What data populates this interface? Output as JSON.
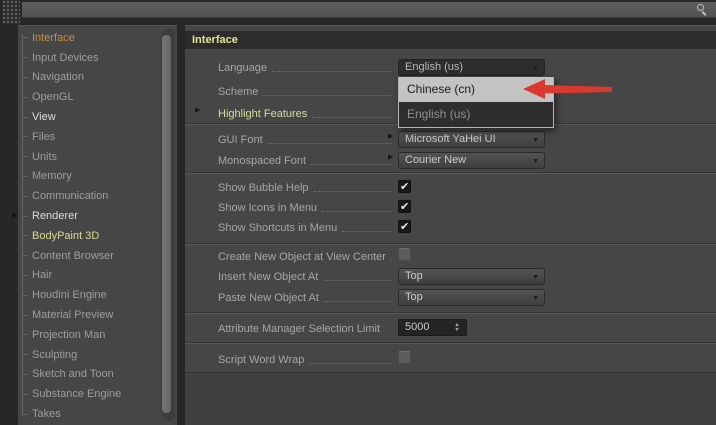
{
  "topbar": {
    "search_icon": "magnifier"
  },
  "icons": {
    "check": "✔",
    "dropdown_arrow": "▼",
    "expand_arrow": "▶",
    "spinner_up": "▲",
    "spinner_down": "▼"
  },
  "sidebar": {
    "items": [
      {
        "label": "Interface",
        "style": "sel"
      },
      {
        "label": "Input Devices"
      },
      {
        "label": "Navigation"
      },
      {
        "label": "OpenGL"
      },
      {
        "label": "View",
        "style": "active"
      },
      {
        "label": "Files"
      },
      {
        "label": "Units"
      },
      {
        "label": "Memory"
      },
      {
        "label": "Communication"
      },
      {
        "label": "Renderer",
        "style": "active",
        "expandable": true
      },
      {
        "label": "BodyPaint 3D",
        "style": "hl"
      },
      {
        "label": "Content Browser"
      },
      {
        "label": "Hair"
      },
      {
        "label": "Houdini Engine"
      },
      {
        "label": "Material Preview"
      },
      {
        "label": "Projection Man"
      },
      {
        "label": "Sculpting"
      },
      {
        "label": "Sketch and Toon"
      },
      {
        "label": "Substance Engine"
      },
      {
        "label": "Takes"
      }
    ]
  },
  "main": {
    "header": "Interface",
    "rows": {
      "language": {
        "label": "Language",
        "value": "English (us)"
      },
      "scheme": {
        "label": "Scheme"
      },
      "highlight_features": {
        "label": "Highlight Features"
      },
      "gui_font": {
        "label": "GUI Font",
        "value": "Microsoft YaHei UI"
      },
      "monospaced_font": {
        "label": "Monospaced Font",
        "value": "Courier New"
      },
      "show_bubble_help": {
        "label": "Show Bubble Help",
        "checked": true
      },
      "show_icons_in_menu": {
        "label": "Show Icons in Menu",
        "checked": true
      },
      "show_shortcuts_in_menu": {
        "label": "Show Shortcuts in Menu",
        "checked": true
      },
      "create_new_object_at_view_center": {
        "label": "Create New Object at View Center",
        "checked": false
      },
      "insert_new_object_at": {
        "label": "Insert New Object At",
        "value": "Top"
      },
      "paste_new_object_at": {
        "label": "Paste New Object At",
        "value": "Top"
      },
      "attribute_manager_selection_limit": {
        "label": "Attribute Manager Selection Limit",
        "value": "5000"
      },
      "script_word_wrap": {
        "label": "Script Word Wrap",
        "checked": false
      }
    },
    "language_menu": {
      "options": [
        {
          "label": "Chinese (cn)",
          "highlighted": true
        },
        {
          "label": "English (us)",
          "highlighted": false
        }
      ]
    }
  },
  "annotation": {
    "type": "arrow",
    "color": "#d93a30",
    "points_to": "Chinese (cn)"
  }
}
